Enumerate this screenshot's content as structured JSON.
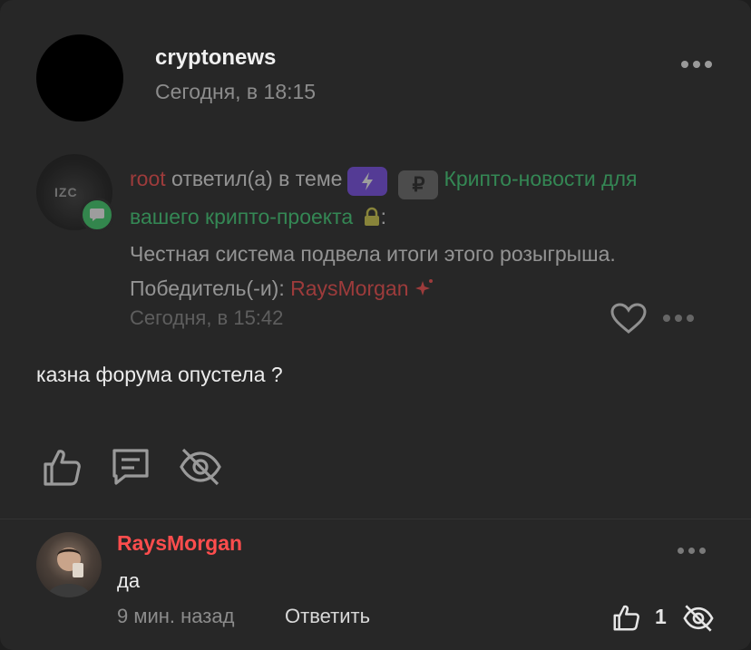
{
  "post": {
    "author": "cryptonews",
    "time": "Сегодня, в 18:15",
    "body": "казна форума опустела ?"
  },
  "quote": {
    "user": "root",
    "action": "ответил(а) в теме",
    "ruble_tag": "₽",
    "thread_title": "Крипто-новости для вашего крипто-проекта",
    "colon": ":",
    "message_prefix": "Честная система подвела итоги этого розыгрыша. Победитель(-и):",
    "winner": "RaysMorgan",
    "time": "Сегодня, в 15:42",
    "avatar_text": "IZC"
  },
  "comment": {
    "author": "RaysMorgan",
    "text": "да",
    "time": "9 мин. назад",
    "reply_label": "Ответить",
    "like_count": "1"
  },
  "icons": {
    "like": "thumbs-up-icon",
    "comment": "comment-icon",
    "hide": "eye-off-icon",
    "heart": "heart-icon",
    "more": "more-dots-icon",
    "lock": "lock-icon",
    "bolt": "lightning-icon",
    "sparkle": "sparkle-icon",
    "chat_badge": "chat-icon"
  },
  "colors": {
    "background": "#272727",
    "accent_red": "#ff4d4d",
    "accent_green": "#3fd67a",
    "purple_tag": "#7a4cf0"
  }
}
